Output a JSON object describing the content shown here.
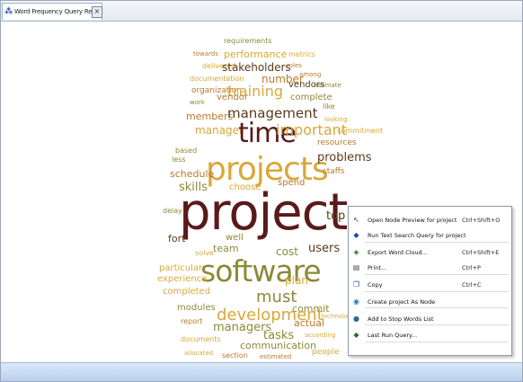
{
  "tab": {
    "title": "Word Frequency Query Result",
    "icon": "query-result-icon",
    "close": "×"
  },
  "cloud_words": [
    {
      "text": "requirements",
      "color": "#8a8a3a"
    },
    {
      "text": "towards",
      "color": "#b87a2a"
    },
    {
      "text": "performance",
      "color": "#d8a83a"
    },
    {
      "text": "metrics",
      "color": "#d8a83a"
    },
    {
      "text": "delivered",
      "color": "#d8a83a"
    },
    {
      "text": "stakeholders",
      "color": "#5a3a1a"
    },
    {
      "text": "roles",
      "color": "#b87a2a"
    },
    {
      "text": "among",
      "color": "#b87a2a"
    },
    {
      "text": "documentation",
      "color": "#d8a83a"
    },
    {
      "text": "number",
      "color": "#b87a2a"
    },
    {
      "text": "vendors",
      "color": "#5a3a1a"
    },
    {
      "text": "estimate",
      "color": "#8a8a3a"
    },
    {
      "text": "organization",
      "color": "#b87a2a"
    },
    {
      "text": "training",
      "color": "#d8a83a"
    },
    {
      "text": "work",
      "color": "#8a8a3a"
    },
    {
      "text": "vendor",
      "color": "#b87a2a"
    },
    {
      "text": "complete",
      "color": "#8a8a3a"
    },
    {
      "text": "members",
      "color": "#b87a2a"
    },
    {
      "text": "management",
      "color": "#5a3a1a"
    },
    {
      "text": "like",
      "color": "#8a8a3a"
    },
    {
      "text": "looking",
      "color": "#d8a83a"
    },
    {
      "text": "manager",
      "color": "#d8a83a"
    },
    {
      "text": "time",
      "color": "#5a1a1a"
    },
    {
      "text": "important",
      "color": "#d8a83a"
    },
    {
      "text": "based",
      "color": "#8a8a3a"
    },
    {
      "text": "commitment",
      "color": "#d8a83a"
    },
    {
      "text": "less",
      "color": "#8a8a3a"
    },
    {
      "text": "resources",
      "color": "#b87a2a"
    },
    {
      "text": "projects",
      "color": "#d8a83a"
    },
    {
      "text": "problems",
      "color": "#5a3a1a"
    },
    {
      "text": "schedule",
      "color": "#b87a2a"
    },
    {
      "text": "skills",
      "color": "#8a8a3a"
    },
    {
      "text": "choose",
      "color": "#d8a83a"
    },
    {
      "text": "spend",
      "color": "#b87a2a"
    },
    {
      "text": "staffs",
      "color": "#b87a2a"
    },
    {
      "text": "project",
      "color": "#5a1a1a"
    },
    {
      "text": "top",
      "color": "#5a3a1a"
    },
    {
      "text": "delay",
      "color": "#8a8a3a"
    },
    {
      "text": "fort",
      "color": "#5a3a1a"
    },
    {
      "text": "well",
      "color": "#8a8a3a"
    },
    {
      "text": "team",
      "color": "#8a8a3a"
    },
    {
      "text": "cost",
      "color": "#8a8a3a"
    },
    {
      "text": "users",
      "color": "#5a3a1a"
    },
    {
      "text": "solve",
      "color": "#d8a83a"
    },
    {
      "text": "software",
      "color": "#8a8a3a"
    },
    {
      "text": "particular",
      "color": "#d8a83a"
    },
    {
      "text": "experience",
      "color": "#d8a83a"
    },
    {
      "text": "completed",
      "color": "#d8a83a"
    },
    {
      "text": "must",
      "color": "#8a8a3a"
    },
    {
      "text": "plan",
      "color": "#d8a83a"
    },
    {
      "text": "modules",
      "color": "#8a8a3a"
    },
    {
      "text": "commit",
      "color": "#8a8a3a"
    },
    {
      "text": "development",
      "color": "#d8a83a"
    },
    {
      "text": "report",
      "color": "#b87a2a"
    },
    {
      "text": "managers",
      "color": "#8a8a3a"
    },
    {
      "text": "tasks",
      "color": "#8a8a3a"
    },
    {
      "text": "actual",
      "color": "#b87a2a"
    },
    {
      "text": "technology",
      "color": "#d8a83a"
    },
    {
      "text": "documents",
      "color": "#d8a83a"
    },
    {
      "text": "according",
      "color": "#d8a83a"
    },
    {
      "text": "communication",
      "color": "#8a8a3a"
    },
    {
      "text": "allocated",
      "color": "#d8a83a"
    },
    {
      "text": "section",
      "color": "#b87a2a"
    },
    {
      "text": "estimated",
      "color": "#b87a2a"
    },
    {
      "text": "people",
      "color": "#d8a83a"
    }
  ],
  "context_menu": {
    "items": [
      {
        "label": "Open Node Preview for project",
        "shortcut": "Ctrl+Shift+O",
        "icon": "preview-icon",
        "icon_glyph": "↖",
        "icon_color": "#1f49a6"
      },
      {
        "label": "Run Text Search Query for project",
        "shortcut": "",
        "icon": "query-icon",
        "icon_glyph": "◆",
        "icon_color": "#1f49a6"
      },
      {
        "label": "Export Word Cloud...",
        "shortcut": "Ctrl+Shift+E",
        "icon": "export-icon",
        "icon_glyph": "◈",
        "icon_color": "#2a6a2a"
      },
      {
        "label": "Print...",
        "shortcut": "Ctrl+P",
        "icon": "print-icon",
        "icon_glyph": "▤",
        "icon_color": "#555"
      },
      {
        "label": "Copy",
        "shortcut": "Ctrl+C",
        "icon": "copy-icon",
        "icon_glyph": "❐",
        "icon_color": "#1f49a6"
      },
      {
        "label": "Create project As Node",
        "shortcut": "",
        "icon": "create-node-icon",
        "icon_glyph": "◉",
        "icon_color": "#1f7ab4"
      },
      {
        "label": "Add to Stop Words List",
        "shortcut": "",
        "icon": "stop-words-icon",
        "icon_glyph": "●",
        "icon_color": "#2a6a9a"
      },
      {
        "label": "Last Run Query...",
        "shortcut": "",
        "icon": "last-query-icon",
        "icon_glyph": "◆",
        "icon_color": "#2a6a2a"
      }
    ]
  }
}
